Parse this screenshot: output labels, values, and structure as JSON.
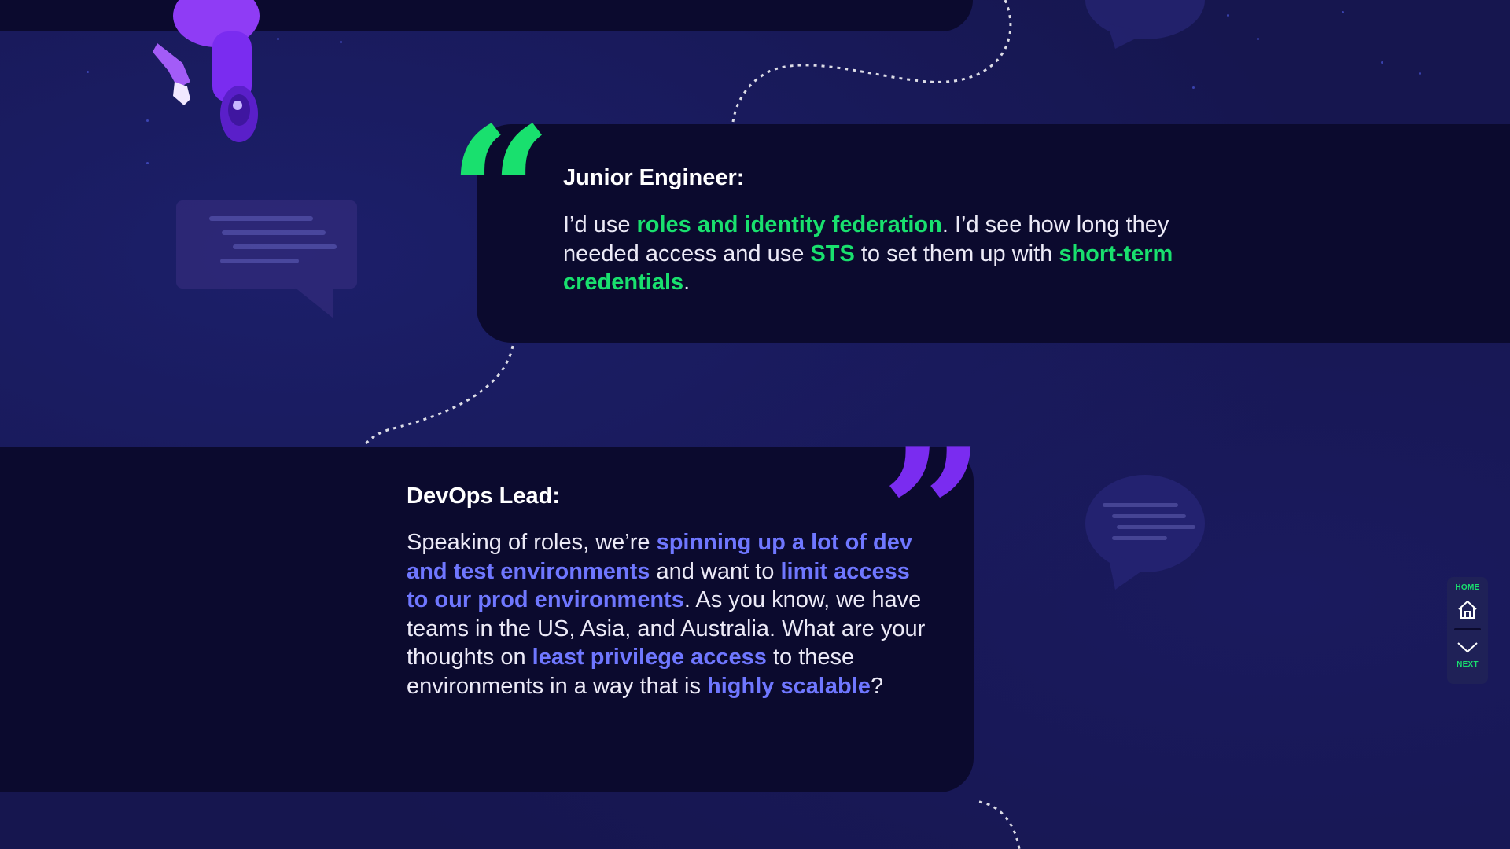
{
  "colors": {
    "background": "#16164f",
    "card": "#0b0a2e",
    "green_accent": "#19e06e",
    "purple_accent": "#7a2cf0",
    "blue_highlight": "#6f77ff"
  },
  "quotes": [
    {
      "speaker": "Junior Engineer:",
      "quote_icon": "open-quote-icon",
      "segments": [
        {
          "text": "I’d use ",
          "highlight": false
        },
        {
          "text": "roles and identity federation",
          "highlight": true
        },
        {
          "text": ". I’d see how long they needed access and use ",
          "highlight": false
        },
        {
          "text": "STS",
          "highlight": true
        },
        {
          "text": " to set them up with ",
          "highlight": false
        },
        {
          "text": "short-term credentials",
          "highlight": true
        },
        {
          "text": ".",
          "highlight": false
        }
      ]
    },
    {
      "speaker": "DevOps Lead:",
      "quote_icon": "close-quote-icon",
      "segments": [
        {
          "text": "Speaking of roles, we’re ",
          "highlight": false
        },
        {
          "text": "spinning up a lot of dev and test environments",
          "highlight": true
        },
        {
          "text": " and want to ",
          "highlight": false
        },
        {
          "text": "limit access to our prod environments",
          "highlight": true
        },
        {
          "text": ". As you know, we have teams in the US, Asia, and Australia. What are your thoughts on ",
          "highlight": false
        },
        {
          "text": "least privilege access",
          "highlight": true
        },
        {
          "text": " to these environments in a way that is ",
          "highlight": false
        },
        {
          "text": "highly scalable",
          "highlight": true
        },
        {
          "text": "?",
          "highlight": false
        }
      ]
    }
  ],
  "nav": {
    "home_label": "HOME",
    "home_icon": "home-icon",
    "next_label": "NEXT",
    "next_icon": "chevron-down-icon"
  }
}
